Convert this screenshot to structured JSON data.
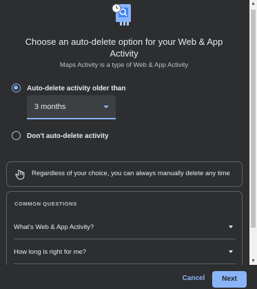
{
  "dialog": {
    "title": "Choose an auto-delete option for your Web & App Activity",
    "subtitle": "Maps Activity is a type of Web & App Activity",
    "hero_icon": "auto-delete-illustration"
  },
  "options": {
    "auto_delete_label": "Auto-delete activity older than",
    "auto_delete_selected": true,
    "duration_value": "3 months",
    "dont_auto_delete_label": "Don't auto-delete activity",
    "dont_auto_delete_selected": false
  },
  "info": {
    "icon": "hand-pointer-icon",
    "text": "Regardless of your choice, you can always manually delete any time"
  },
  "faq": {
    "heading": "COMMON QUESTIONS",
    "items": [
      {
        "label": "What's Web & App Activity?"
      },
      {
        "label": "How long is right for me?"
      }
    ]
  },
  "footer": {
    "cancel_label": "Cancel",
    "next_label": "Next"
  },
  "colors": {
    "background": "#2d2e30",
    "accent": "#8ab4f8",
    "text": "#e8eaed",
    "border": "#5f6368"
  }
}
